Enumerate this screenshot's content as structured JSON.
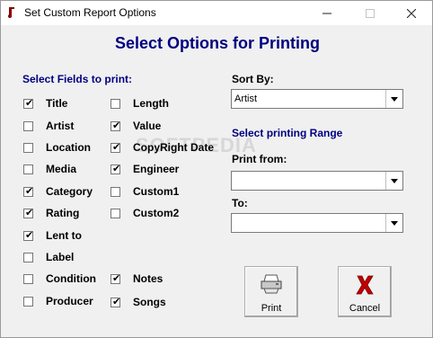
{
  "window": {
    "title": "Set Custom Report Options"
  },
  "heading": "Select Options for Printing",
  "fields_label": "Select Fields to print:",
  "fields_left": [
    {
      "label": "Title",
      "checked": true
    },
    {
      "label": "Artist",
      "checked": false
    },
    {
      "label": "Location",
      "checked": false
    },
    {
      "label": "Media",
      "checked": false
    },
    {
      "label": "Category",
      "checked": true
    },
    {
      "label": "Rating",
      "checked": true
    },
    {
      "label": "Lent to",
      "checked": true
    },
    {
      "label": "Label",
      "checked": false
    },
    {
      "label": "Condition",
      "checked": false
    },
    {
      "label": "Producer",
      "checked": false
    }
  ],
  "fields_right": [
    {
      "label": "Length",
      "checked": false
    },
    {
      "label": "Value",
      "checked": true
    },
    {
      "label": "CopyRight Date",
      "checked": true
    },
    {
      "label": "Engineer",
      "checked": true
    },
    {
      "label": "Custom1",
      "checked": false
    },
    {
      "label": "Custom2",
      "checked": false
    },
    {
      "label": "Notes",
      "checked": true
    },
    {
      "label": "Songs",
      "checked": true
    }
  ],
  "sort_by": {
    "label": "Sort By:",
    "value": "Artist"
  },
  "range_label": "Select printing Range",
  "print_from": {
    "label": "Print from:",
    "value": ""
  },
  "print_to": {
    "label": "To:",
    "value": ""
  },
  "buttons": {
    "print": "Print",
    "cancel": "Cancel"
  },
  "watermark": "SOFTPEDIA",
  "colors": {
    "heading": "#000080",
    "cancel_x": "#c00000"
  }
}
